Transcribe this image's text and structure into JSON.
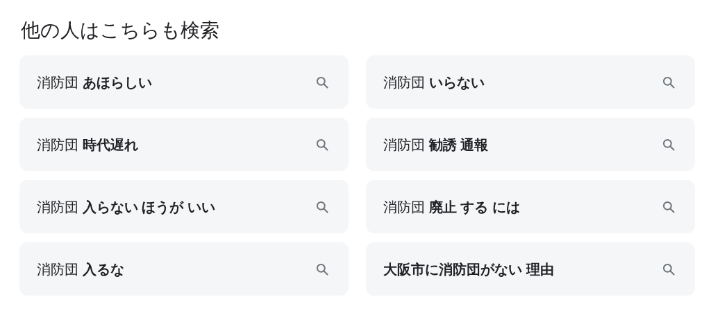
{
  "title": "他の人はこちらも検索",
  "suggestions": [
    {
      "text": "消防団 **あほらしい**"
    },
    {
      "text": "消防団 **いらない**"
    },
    {
      "text": "消防団 **時代遅れ**"
    },
    {
      "text": "消防団 **勧誘 通報**"
    },
    {
      "text": "消防団 **入らない ほうが いい**"
    },
    {
      "text": "消防団 **廃止 する には**"
    },
    {
      "text": "消防団 **入るな**"
    },
    {
      "text": "**大阪市に消防団がない 理由**"
    }
  ]
}
